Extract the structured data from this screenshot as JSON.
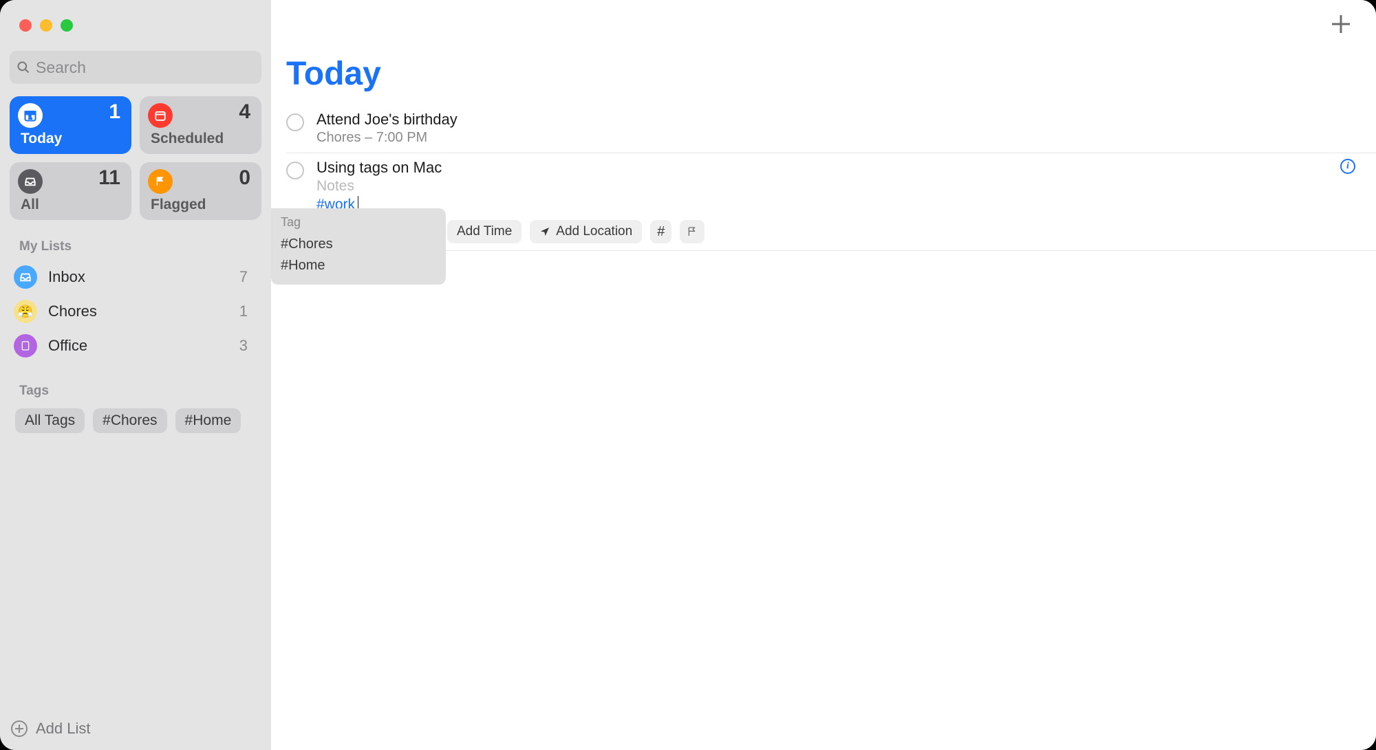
{
  "sidebar": {
    "search_placeholder": "Search",
    "smart_lists": [
      {
        "label": "Today",
        "count": "1"
      },
      {
        "label": "Scheduled",
        "count": "4"
      },
      {
        "label": "All",
        "count": "11"
      },
      {
        "label": "Flagged",
        "count": "0"
      }
    ],
    "my_lists_heading": "My Lists",
    "lists": [
      {
        "name": "Inbox",
        "count": "7"
      },
      {
        "name": "Chores",
        "count": "1"
      },
      {
        "name": "Office",
        "count": "3"
      }
    ],
    "tags_heading": "Tags",
    "tags": [
      "All Tags",
      "#Chores",
      "#Home"
    ],
    "add_list_label": "Add List"
  },
  "main": {
    "title": "Today",
    "reminders": [
      {
        "title": "Attend Joe's birthday",
        "subtitle": "Chores – 7:00 PM"
      },
      {
        "title": "Using tags on Mac",
        "notes_placeholder": "Notes",
        "tag_input": "#work"
      }
    ],
    "inline_toolbar": {
      "add_time": "Add Time",
      "add_location": "Add Location"
    },
    "tag_popup": {
      "heading": "Tag",
      "options": [
        "#Chores",
        "#Home"
      ]
    }
  }
}
